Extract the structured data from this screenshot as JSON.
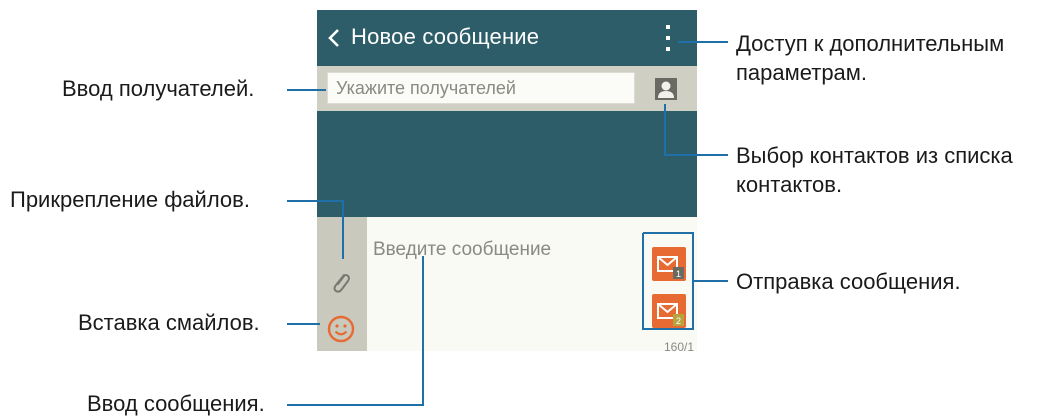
{
  "phone": {
    "app_title": "Новое сообщение",
    "recipients_placeholder": "Укажите получателей",
    "message_placeholder": "Введите сообщение",
    "counter": "160/1",
    "send_badges": [
      "1",
      "2"
    ],
    "colors": {
      "app_bar": "#2c5d68",
      "recipient_bar": "#cfcfc4",
      "compose_background": "#fafaf4",
      "send_button": "#e66a32",
      "emoji_icon": "#e66a32",
      "callout_line": "#1f6fa8"
    },
    "icons": [
      "back-icon",
      "menu-icon",
      "contact-icon",
      "attach-icon",
      "emoji-icon",
      "send-message-icon"
    ]
  },
  "callouts": {
    "recipients": "Ввод получателей.",
    "attach": "Прикрепление файлов.",
    "emoticons": "Вставка смайлов.",
    "message": "Ввод сообщения.",
    "more_options_1": "Доступ к дополнительным",
    "more_options_2": "параметрам.",
    "contacts_1": "Выбор контактов из списка",
    "contacts_2": "контактов.",
    "send": "Отправка сообщения."
  }
}
